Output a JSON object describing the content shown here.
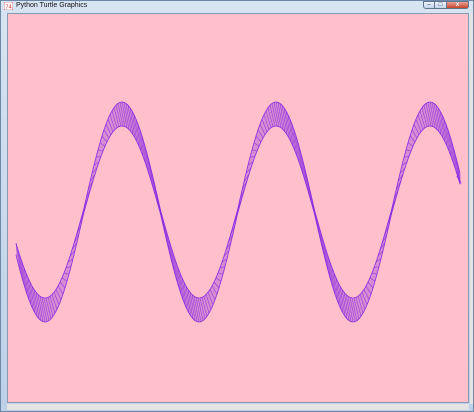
{
  "window": {
    "title": "Python Turtle Graphics",
    "app_icon_text": "74",
    "controls": {
      "minimize": "–",
      "maximize": "□",
      "close": "x"
    }
  },
  "canvas": {
    "background_color": "#ffc0cb",
    "pen_color": "#8b2be2",
    "drawing": "sine-wave ribbon",
    "turtle_icon": "arrow-cursor"
  }
}
